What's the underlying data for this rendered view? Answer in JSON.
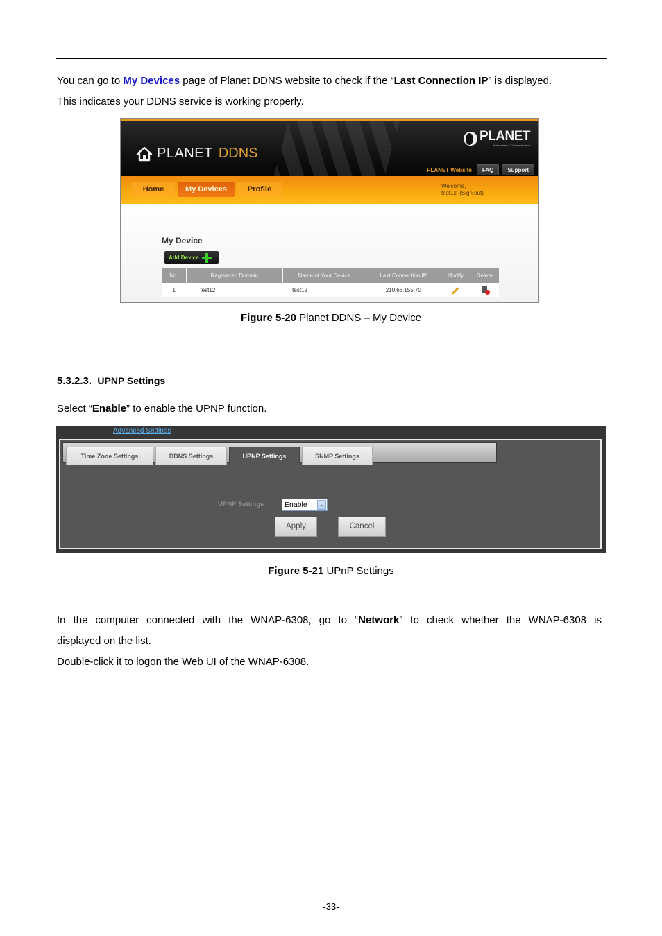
{
  "doc": {
    "intro_line1": {
      "pre": "You can go to ",
      "link": "My Devices",
      "mid": " page of Planet DDNS website to check if the “",
      "bold": "Last Connection IP",
      "post": "” is displayed."
    },
    "intro_line2": "This indicates your DDNS service is working properly.",
    "figure1_caption": {
      "label": "Figure 5-20",
      "text": " Planet DDNS – My Device"
    },
    "section_number": "5.3.2.3.",
    "section_title": "UPNP Settings",
    "select_instruction": {
      "pre": "Select “",
      "bold": "Enable",
      "post": "” to enable the UPNP function."
    },
    "figure2_caption": {
      "label": "Figure 5-21",
      "text": " UPnP Settings"
    },
    "network_para": {
      "words_line1": [
        "In",
        "the",
        "computer",
        "connected",
        "with",
        "the",
        "WNAP-6308,",
        "go",
        "to",
        "“Network”",
        "to",
        "check",
        "whether",
        "the",
        "WNAP-6308",
        "is"
      ],
      "line2": "displayed on the list.",
      "line3": "Double-click it to logon the Web UI of the WNAP-6308."
    },
    "page_number": "-33-",
    "link_color": "#1a1acc"
  },
  "ddns_site": {
    "logo_planet": "PLANET",
    "logo_ddns": "DDNS",
    "brand": "PLANET",
    "brand_tagline": "Networking & Communication",
    "top_links": {
      "website": "PLANET Website",
      "faq": "FAQ",
      "support": "Support"
    },
    "nav": [
      {
        "label": "Home",
        "active": false
      },
      {
        "label": "My Devices",
        "active": true
      },
      {
        "label": "Profile",
        "active": false
      }
    ],
    "welcome_line1": "Welcome,",
    "welcome_user": "test12",
    "sign_out": "(Sign out)",
    "page_title": "My Device",
    "add_device": "Add Device",
    "table": {
      "headers": [
        "No.",
        "Registered Domain",
        "Name of Your Device",
        "Last Connection IP",
        "Modify",
        "Delete"
      ],
      "rows": [
        {
          "no": "1",
          "domain": "test12",
          "device_name": "test12",
          "last_ip": "210.66.155.70",
          "modify": "pencil-icon",
          "delete": "trash-icon"
        }
      ]
    },
    "accent_orange": "#f9a810"
  },
  "upnp_ui": {
    "section_link": "Advanced Settings",
    "tabs": [
      {
        "label": "Time Zone Settings",
        "active": false
      },
      {
        "label": "DDNS Settings",
        "active": false
      },
      {
        "label": "UPNP Settings",
        "active": true
      },
      {
        "label": "SNMP Settings",
        "active": false
      }
    ],
    "field_label": "UPNP Settings",
    "field_value": "Enable",
    "apply": "Apply",
    "cancel": "Cancel"
  }
}
